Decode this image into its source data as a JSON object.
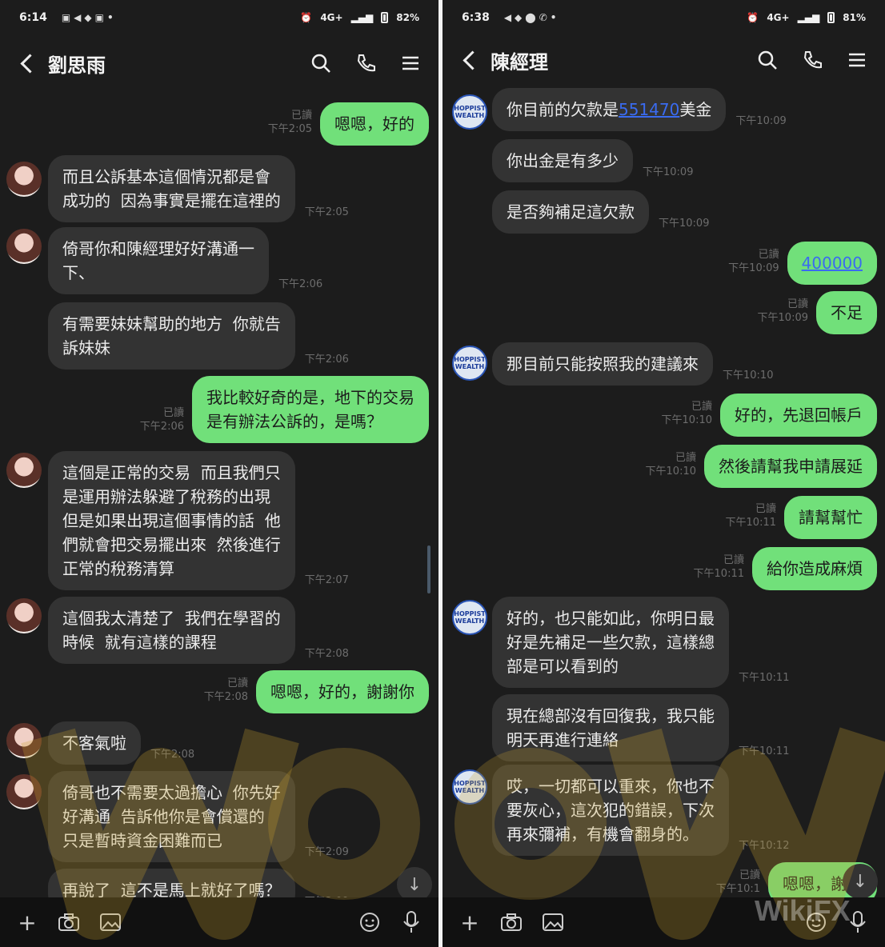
{
  "left": {
    "status": {
      "time": "6:14",
      "battery": "82%",
      "network": "4G+"
    },
    "header": {
      "title": "劉思雨"
    },
    "messages": [
      {
        "dir": "out",
        "read": "已讀",
        "time": "下午2:05",
        "text": "嗯嗯，好的"
      },
      {
        "dir": "in",
        "avatar": true,
        "time": "下午2:05",
        "text": "而且公訴基本這個情況都是會\n成功的  因為事實是擺在這裡的"
      },
      {
        "dir": "in",
        "avatar": true,
        "time": "下午2:06",
        "text": "倚哥你和陳經理好好溝通一\n下、"
      },
      {
        "dir": "in",
        "avatar": false,
        "time": "下午2:06",
        "text": "有需要妹妹幫助的地方  你就告\n訴妹妹"
      },
      {
        "dir": "out",
        "read": "已讀",
        "time": "下午2:06",
        "text": "我比較好奇的是，地下的交易\n是有辦法公訴的，是嗎？"
      },
      {
        "dir": "in",
        "avatar": true,
        "time": "下午2:07",
        "text": "這個是正常的交易  而且我們只\n是運用辦法躲避了稅務的出現\n但是如果出現這個事情的話  他\n們就會把交易擺出來  然後進行\n正常的稅務清算"
      },
      {
        "dir": "in",
        "avatar": true,
        "time": "下午2:08",
        "text": "這個我太清楚了  我們在學習的\n時候  就有這樣的課程"
      },
      {
        "dir": "out",
        "read": "已讀",
        "time": "下午2:08",
        "text": "嗯嗯，好的，謝謝你"
      },
      {
        "dir": "in",
        "avatar": true,
        "time": "下午2:08",
        "text": "不客氣啦"
      },
      {
        "dir": "in",
        "avatar": true,
        "time": "下午2:09",
        "text": "倚哥也不需要太過擔心  你先好\n好溝通  告訴他你是會償還的\n只是暫時資金困難而已"
      },
      {
        "dir": "in",
        "avatar": false,
        "time": "下午2:09",
        "text": "再說了  這不是馬上就好了嗎？"
      }
    ]
  },
  "right": {
    "status": {
      "time": "6:38",
      "battery": "81%",
      "network": "4G+"
    },
    "header": {
      "title": "陳經理"
    },
    "messages": [
      {
        "dir": "in",
        "avatar": true,
        "time": "下午10:09",
        "pre": "你目前的欠款是",
        "link": "551470",
        "post": "美金"
      },
      {
        "dir": "in",
        "avatar": false,
        "time": "下午10:09",
        "text": "你出金是有多少"
      },
      {
        "dir": "in",
        "avatar": false,
        "time": "下午10:09",
        "text": "是否夠補足這欠款"
      },
      {
        "dir": "out",
        "read": "已讀",
        "time": "下午10:09",
        "link": "400000"
      },
      {
        "dir": "out",
        "read": "已讀",
        "time": "下午10:09",
        "text": "不足"
      },
      {
        "dir": "in",
        "avatar": true,
        "time": "下午10:10",
        "text": "那目前只能按照我的建議來"
      },
      {
        "dir": "out",
        "read": "已讀",
        "time": "下午10:10",
        "text": "好的，先退回帳戶"
      },
      {
        "dir": "out",
        "read": "已讀",
        "time": "下午10:10",
        "text": "然後請幫我申請展延"
      },
      {
        "dir": "out",
        "read": "已讀",
        "time": "下午10:11",
        "text": "請幫幫忙"
      },
      {
        "dir": "out",
        "read": "已讀",
        "time": "下午10:11",
        "text": "給你造成麻煩"
      },
      {
        "dir": "in",
        "avatar": true,
        "time": "下午10:11",
        "text": "好的，也只能如此，你明日最\n好是先補足一些欠款，這樣總\n部是可以看到的"
      },
      {
        "dir": "in",
        "avatar": false,
        "time": "下午10:11",
        "text": "現在總部沒有回復我，我只能\n明天再進行連絡"
      },
      {
        "dir": "in",
        "avatar": true,
        "time": "下午10:12",
        "text": "哎，一切都可以重來，你也不\n要灰心，這次犯的錯誤，下次\n再來彌補，有機會翻身的。"
      },
      {
        "dir": "out",
        "read": "已讀",
        "time": "下午10:1",
        "text": "嗯嗯，謝謝"
      }
    ]
  },
  "avatar_logo_text": "HOPPIST\nWEALTH",
  "watermark": "WikiFX",
  "colors": {
    "outgoing": "#71e07a",
    "incoming": "#333333",
    "background": "#1c1c1c",
    "link": "#3a6bf0"
  },
  "icons": [
    "back-icon",
    "search-icon",
    "phone-icon",
    "menu-icon",
    "plus-icon",
    "camera-icon",
    "image-icon",
    "emoji-icon",
    "mic-icon",
    "arrow-down-icon"
  ]
}
